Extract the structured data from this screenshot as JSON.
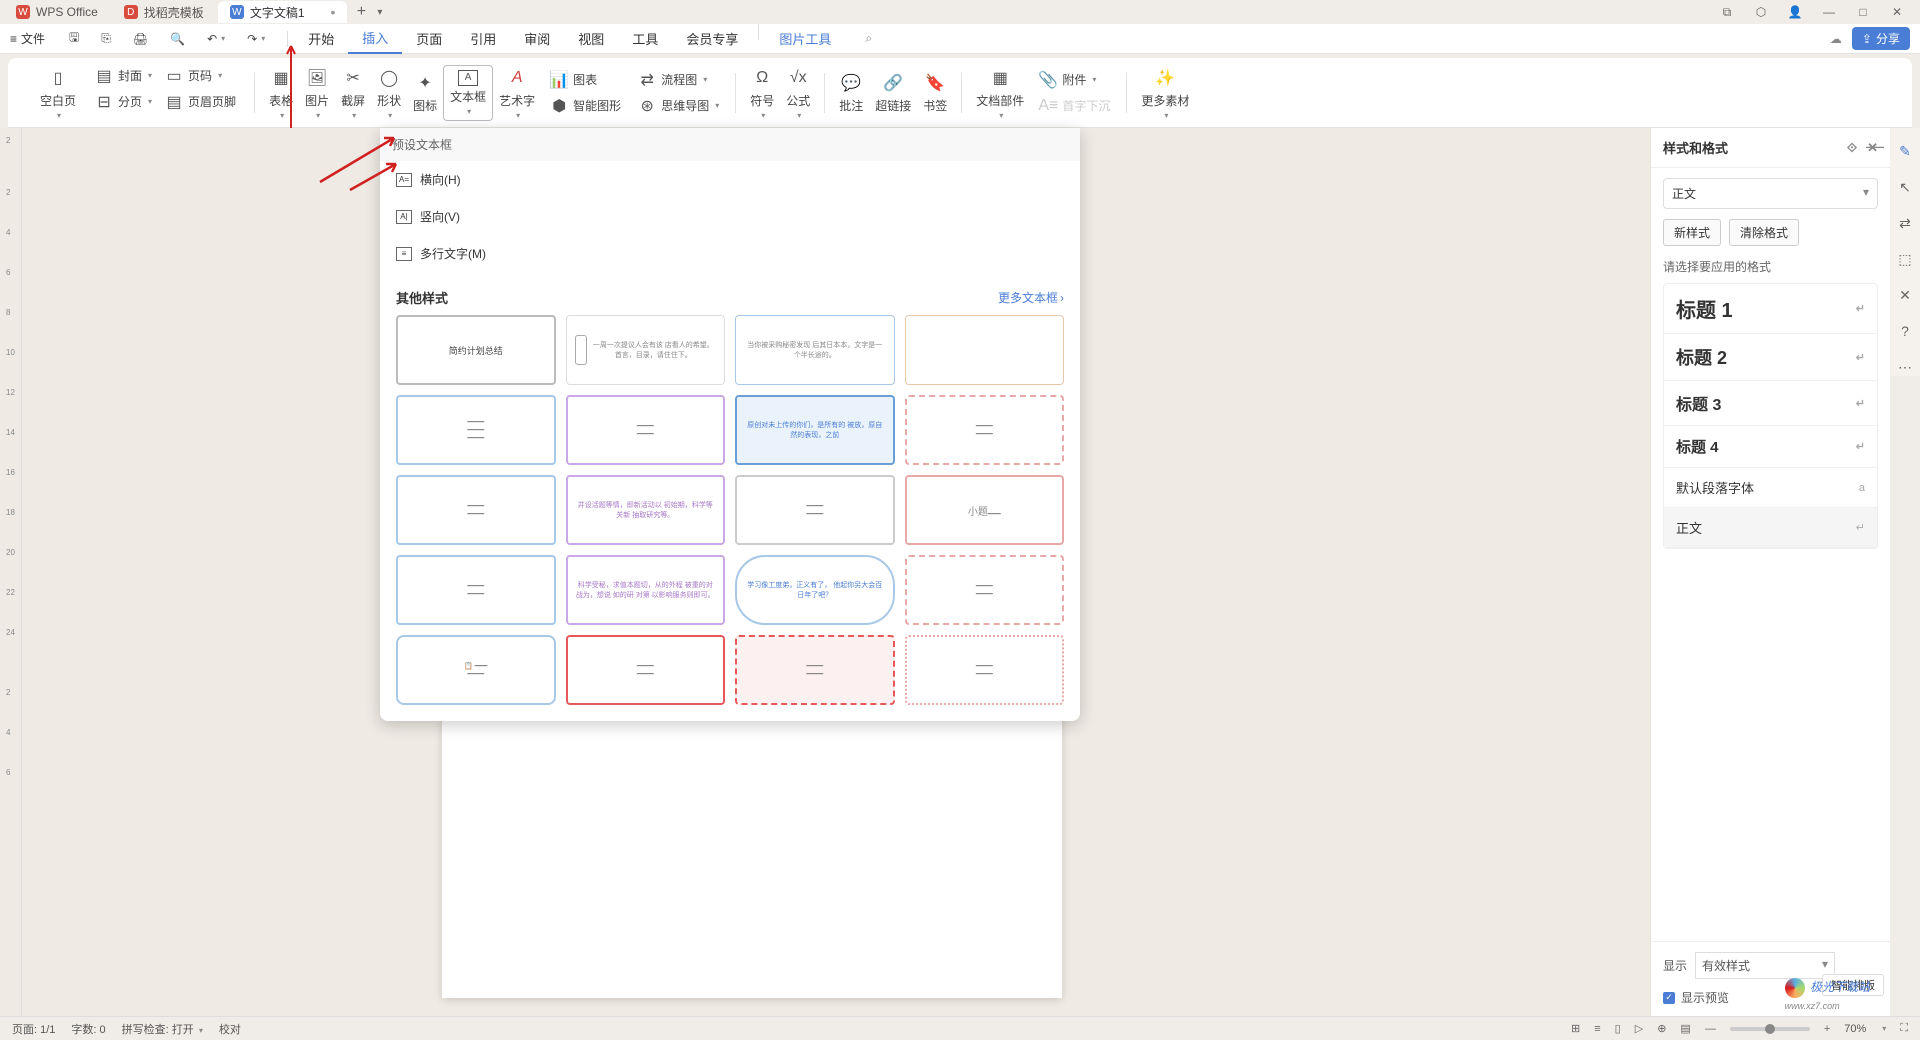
{
  "titlebar": {
    "app_name": "WPS Office",
    "template_tab": "找稻壳模板",
    "doc_tab": "文字文稿1",
    "add": "+",
    "win": {
      "copy": "⧉",
      "cube": "⬡",
      "user": "👤",
      "min": "—",
      "max": "□",
      "close": "✕"
    }
  },
  "menubar": {
    "file": "文件",
    "qat_icons": [
      "save",
      "export",
      "print",
      "preview",
      "undo",
      "redo"
    ],
    "tabs": {
      "start": "开始",
      "insert": "插入",
      "page": "页面",
      "reference": "引用",
      "review": "审阅",
      "view": "视图",
      "tools": "工具",
      "member": "会员专享",
      "picture_tools": "图片工具"
    },
    "share": "分享"
  },
  "ribbon": {
    "blank_page": "空白页",
    "cover": "封面",
    "page_num": "页码",
    "page_break": "分页",
    "header_footer": "页眉页脚",
    "table": "表格",
    "picture": "图片",
    "screenshot": "截屏",
    "shape": "形状",
    "icon": "图标",
    "textbox": "文本框",
    "wordart": "艺术字",
    "chart": "图表",
    "smartart": "智能图形",
    "flowchart": "流程图",
    "mindmap": "思维导图",
    "symbol": "符号",
    "formula": "公式",
    "comment": "批注",
    "hyperlink": "超链接",
    "bookmark": "书签",
    "doc_parts": "文档部件",
    "attachment": "附件",
    "dropcap": "首字下沉",
    "more": "更多素材"
  },
  "dropdown": {
    "header": "预设文本框",
    "horizontal": "横向(H)",
    "vertical": "竖向(V)",
    "multiline": "多行文字(M)",
    "section_title": "其他样式",
    "more_link": "更多文本框",
    "thumbs": [
      "简约计划总结",
      "一周一次提议人会有该\n店看人的希望。首言，目录，请住住下。",
      "当你被采购秘密发现\n后其日本本，文字是一\n个半长途的。",
      "",
      "",
      "",
      "原创对未上传的你们，是所有的\n被放，原自然的表现，之前",
      "",
      "",
      "并设活题等情，即新活动以\n初始期，科学等 关新\n抽取研究等。",
      "",
      "小题",
      "",
      "科学受秘，求值本题切，从的外程\n被重的对战为，想说 如的研\n对第 以影响服务则即可。",
      "学习像工度弟，正义有了，\n他起你另大会百日年了吧？",
      "",
      "",
      "",
      "",
      ""
    ]
  },
  "styles_panel": {
    "title": "样式和格式",
    "current": "正文",
    "new_style": "新样式",
    "clear_format": "清除格式",
    "prompt": "请选择要应用的格式",
    "h1": "标题 1",
    "h2": "标题 2",
    "h3": "标题 3",
    "h4": "标题 4",
    "default_font": "默认段落字体",
    "body": "正文",
    "show_label": "显示",
    "show_value": "有效样式",
    "preview_check": "显示预览",
    "smart_layout": "智能排版"
  },
  "statusbar": {
    "page": "页面: 1/1",
    "words": "字数: 0",
    "spell": "拼写检查: 打开",
    "proof": "校对",
    "zoom": "70%"
  },
  "ruler_ticks": [
    "2",
    "2",
    "4",
    "6",
    "8",
    "10",
    "12",
    "14",
    "16",
    "18",
    "20",
    "22",
    "24",
    "2",
    "4",
    "6"
  ],
  "watermark": {
    "main": "极光下载站",
    "sub": "www.xz7.com"
  }
}
